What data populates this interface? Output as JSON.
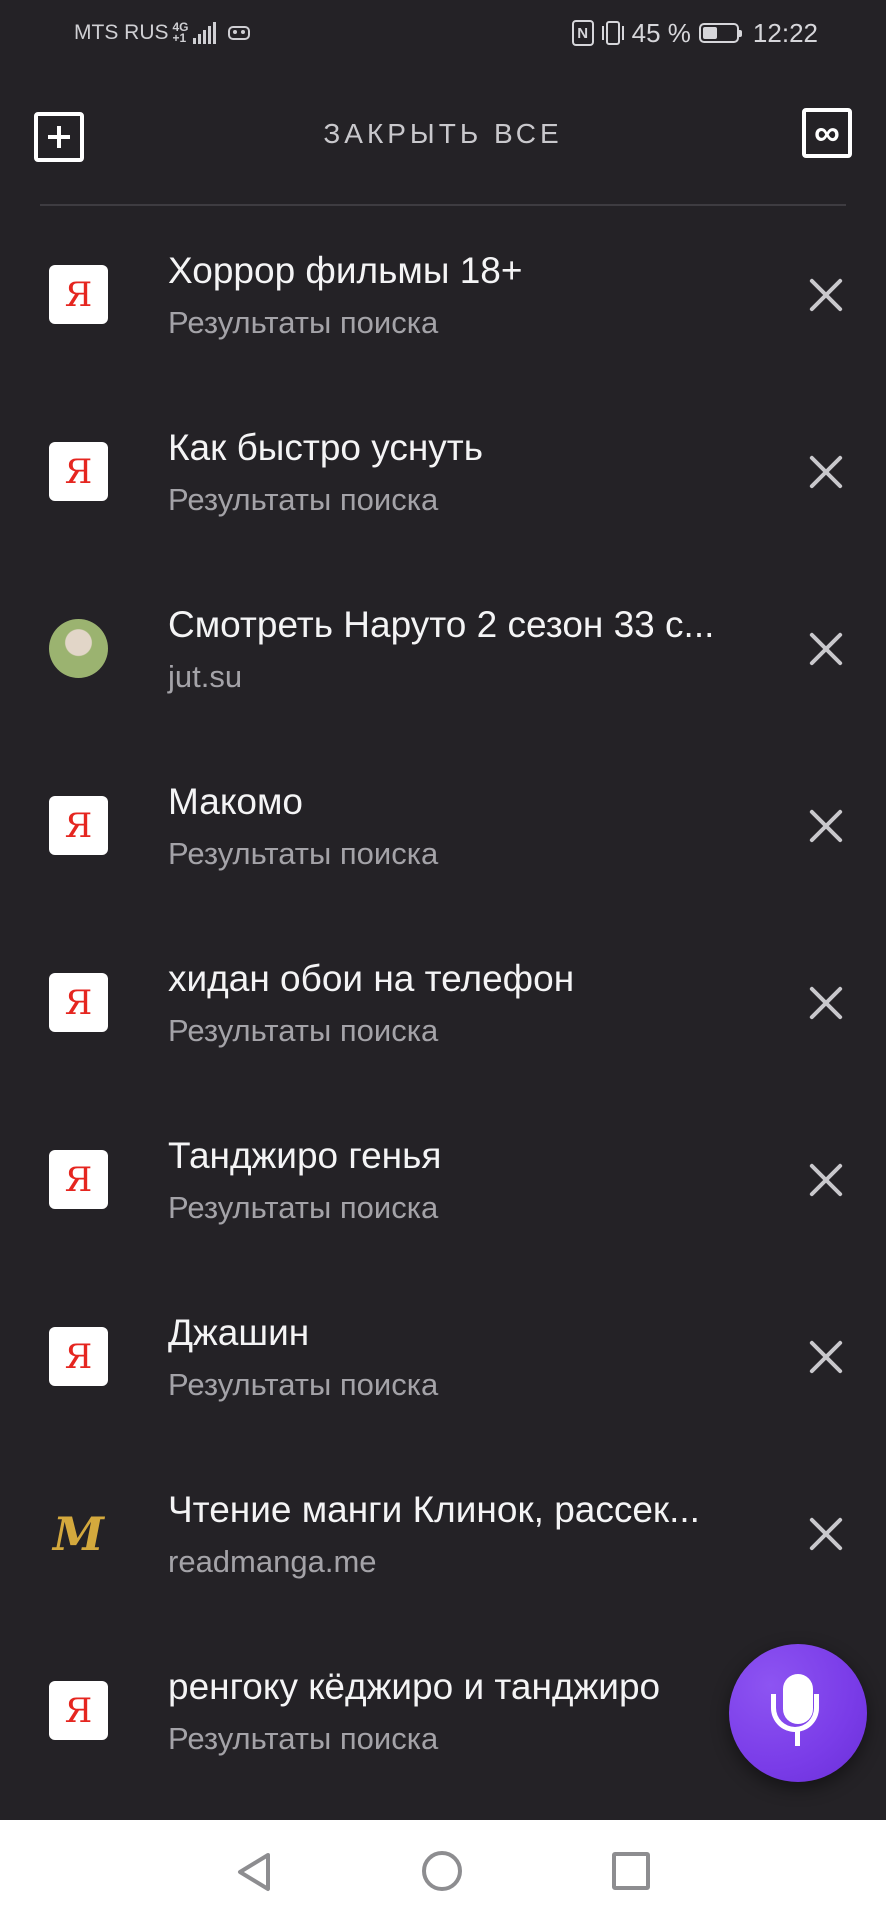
{
  "status_bar": {
    "carrier": "MTS RUS",
    "network_top": "4G",
    "network_bottom": "+1",
    "battery_percent": "45 %",
    "battery_level": 0.45,
    "time": "12:22",
    "icons": [
      "signal-icon",
      "vr-icon",
      "nfc-icon",
      "vibrate-icon",
      "battery-icon"
    ]
  },
  "toolbar": {
    "close_all_label": "ЗАКРЫТЬ ВСЕ",
    "incognito_label": "∞",
    "new_tab_icon": "plus-square-icon"
  },
  "tabs": [
    {
      "title": "Хоррор фильмы 18+",
      "subtitle": "Результаты поиска",
      "favicon": "yandex",
      "favicon_text": "Я"
    },
    {
      "title": "Как быстро уснуть",
      "subtitle": "Результаты поиска",
      "favicon": "yandex",
      "favicon_text": "Я"
    },
    {
      "title": "Смотреть Наруто 2 сезон 33 с...",
      "subtitle": "jut.su",
      "favicon": "jut",
      "favicon_text": ""
    },
    {
      "title": "Макомо",
      "subtitle": "Результаты поиска",
      "favicon": "yandex",
      "favicon_text": "Я"
    },
    {
      "title": "хидан обои на телефон",
      "subtitle": "Результаты поиска",
      "favicon": "yandex",
      "favicon_text": "Я"
    },
    {
      "title": "Танджиро генья",
      "subtitle": "Результаты поиска",
      "favicon": "yandex",
      "favicon_text": "Я"
    },
    {
      "title": "Джашин",
      "subtitle": "Результаты поиска",
      "favicon": "yandex",
      "favicon_text": "Я"
    },
    {
      "title": "Чтение манги Клинок, рассек...",
      "subtitle": "readmanga.me",
      "favicon": "manga",
      "favicon_text": "M"
    },
    {
      "title": "ренгоку кёджиро и танджиро",
      "subtitle": "Результаты поиска",
      "favicon": "yandex",
      "favicon_text": "Я"
    }
  ],
  "colors": {
    "background": "#242226",
    "yandex_red": "#e52620",
    "voice_purple": "#7a3ce8"
  },
  "voice_button_icon": "microphone-icon",
  "nav_bar": {
    "icons": [
      "back-triangle-icon",
      "home-circle-icon",
      "recent-square-icon"
    ]
  }
}
